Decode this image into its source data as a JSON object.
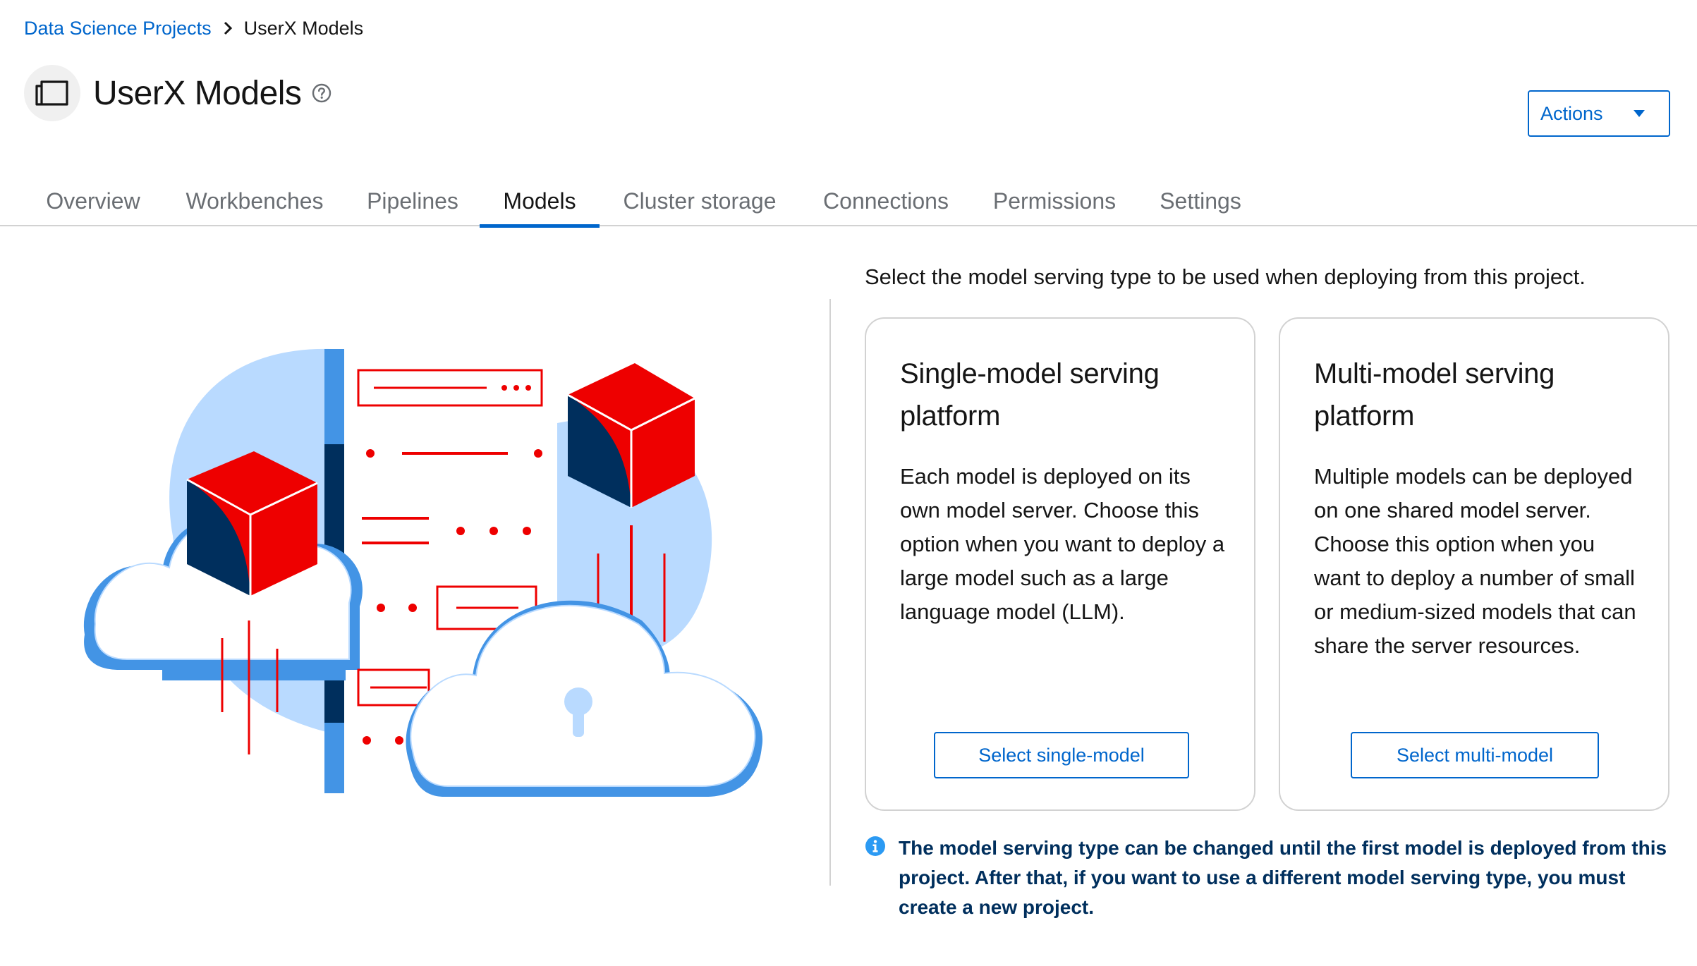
{
  "breadcrumb": {
    "parent": "Data Science Projects",
    "current": "UserX Models"
  },
  "header": {
    "title": "UserX Models",
    "icon": "project-folder-icon",
    "actions_label": "Actions"
  },
  "tabs": [
    {
      "label": "Overview",
      "active": false
    },
    {
      "label": "Workbenches",
      "active": false
    },
    {
      "label": "Pipelines",
      "active": false
    },
    {
      "label": "Models",
      "active": true
    },
    {
      "label": "Cluster storage",
      "active": false
    },
    {
      "label": "Connections",
      "active": false
    },
    {
      "label": "Permissions",
      "active": false
    },
    {
      "label": "Settings",
      "active": false
    }
  ],
  "main": {
    "intro": "Select the model serving type to be used when deploying from this project.",
    "cards": [
      {
        "title": "Single-model serving platform",
        "body": "Each model is deployed on its own model server. Choose this option when you want to deploy a large model such as a large language model (LLM).",
        "button": "Select single-model"
      },
      {
        "title": "Multi-model serving platform",
        "body": "Multiple models can be deployed on one shared model server. Choose this option when you want to deploy a number of small or medium-sized models that can share the server resources.",
        "button": "Select multi-model"
      }
    ],
    "info": "The model serving type can be changed until the first model is deployed from this project. After that, if you want to use a different model serving type, you must create a new project."
  },
  "colors": {
    "link": "#0066cc",
    "accent_red": "#ee0000",
    "navy": "#002f5d",
    "light_blue": "#b9daff",
    "mid_blue": "#4394e5"
  }
}
